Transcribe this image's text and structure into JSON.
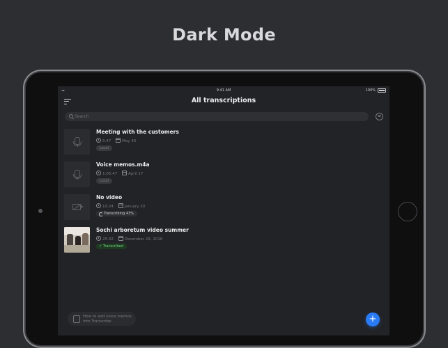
{
  "headline": "Dark Mode",
  "status_bar": {
    "time": "9:41 AM",
    "battery": "100%"
  },
  "nav": {
    "title": "All transcriptions"
  },
  "search": {
    "placeholder": "Search",
    "value": ""
  },
  "items": [
    {
      "title": "Meeting with the customers",
      "duration": "5:47",
      "date": "May 30",
      "status": "Local",
      "thumbnail": "mic-icon"
    },
    {
      "title": "Voice memos.m4a",
      "duration": "1:05:47",
      "date": "April 17",
      "status": "Local",
      "thumbnail": "mic-icon"
    },
    {
      "title": "No video",
      "duration": "10:24",
      "date": "January 30",
      "status": "Transcribing 43%",
      "progress_percent": 43,
      "thumbnail": "no-video-icon"
    },
    {
      "title": "Sochi arboretum video summer",
      "duration": "25:32",
      "date": "December 29, 2016",
      "status": "Transcribed",
      "thumbnail": "photo"
    }
  ],
  "bottom_tip": {
    "text": "How to add voice memos into Transcribe"
  },
  "fab": {
    "label": "+"
  },
  "colors": {
    "background": "#2d2e31",
    "screen": "#222326",
    "accent": "#2a7cf6",
    "success": "#6fd27a",
    "muted": "#77787c"
  }
}
